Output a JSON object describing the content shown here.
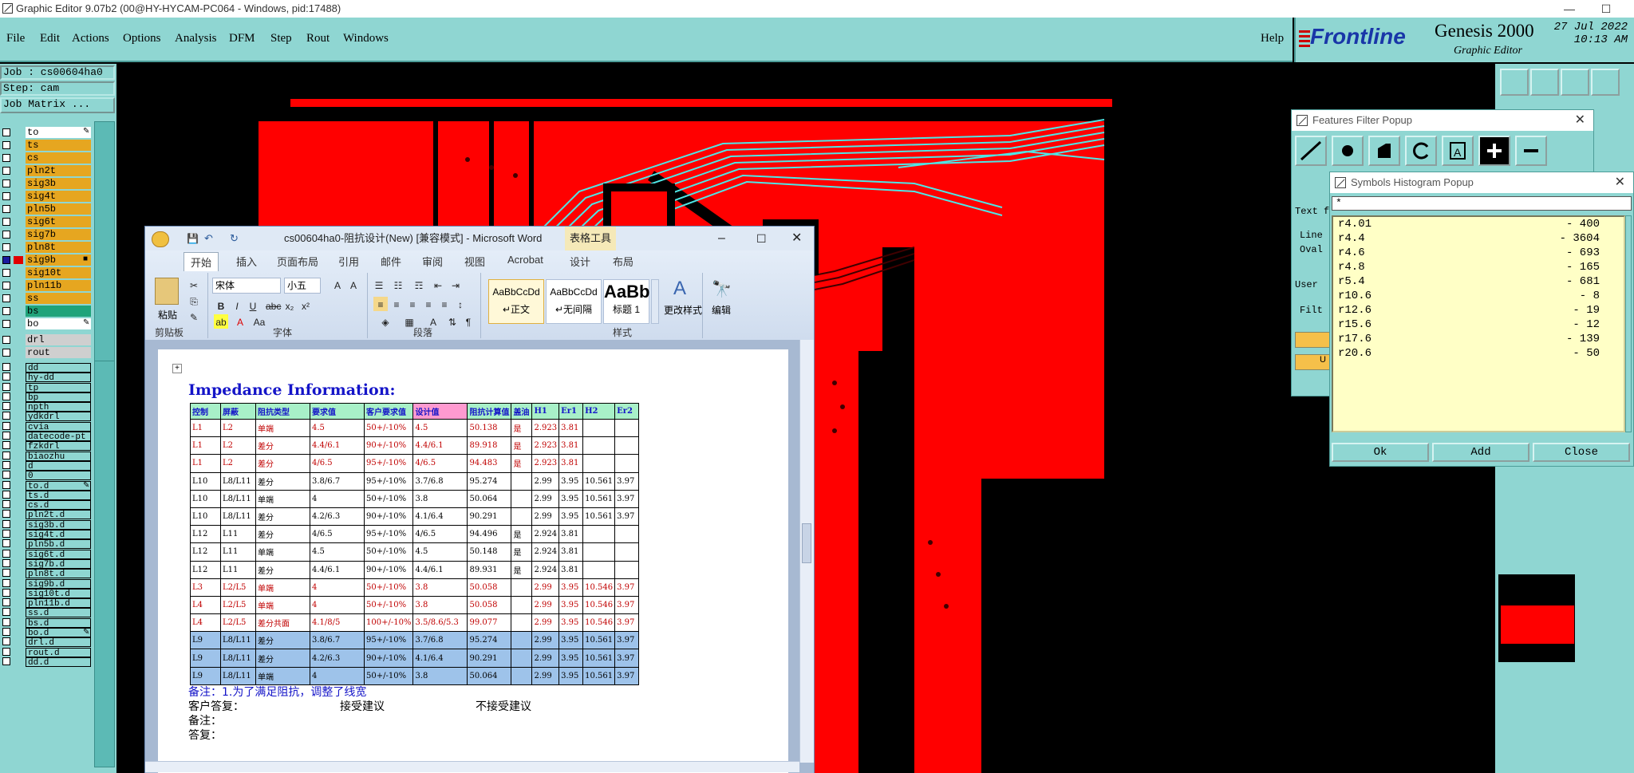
{
  "window": {
    "title": "Graphic Editor 9.07b2 (00@HY-HYCAM-PC064 - Windows, pid:17488)",
    "min": "—",
    "max": "☐",
    "close": "✕"
  },
  "menu": [
    "File",
    "Edit",
    "Actions",
    "Options",
    "Analysis",
    "DFM",
    "Step",
    "Rout",
    "Windows"
  ],
  "help": "Help",
  "brand": {
    "logo": "Frontline",
    "product": "Genesis 2000",
    "subtitle": "Graphic Editor",
    "date": "27 Jul 2022",
    "time": "10:13 AM"
  },
  "job": {
    "job": "Job : cs00604ha0",
    "step": "Step: cam",
    "matrix": "Job Matrix ..."
  },
  "layers_board": [
    {
      "name": "to",
      "color": "#ffffff",
      "sel": false,
      "mark": "✎"
    },
    {
      "name": "ts",
      "color": "#e6a620",
      "sel": false
    },
    {
      "name": "cs",
      "color": "#e6a620",
      "sel": false
    },
    {
      "name": "pln2t",
      "color": "#e6a620",
      "sel": false
    },
    {
      "name": "sig3b",
      "color": "#e6a620",
      "sel": false
    },
    {
      "name": "sig4t",
      "color": "#e6a620",
      "sel": false
    },
    {
      "name": "pln5b",
      "color": "#e6a620",
      "sel": false
    },
    {
      "name": "sig6t",
      "color": "#e6a620",
      "sel": false
    },
    {
      "name": "sig7b",
      "color": "#e6a620",
      "sel": false
    },
    {
      "name": "pln8t",
      "color": "#e6a620",
      "sel": false
    },
    {
      "name": "sig9b",
      "color": "#e6a620",
      "sel": true,
      "swatch": "#e00000",
      "mark": "■"
    },
    {
      "name": "sig10t",
      "color": "#e6a620",
      "sel": false
    },
    {
      "name": "pln11b",
      "color": "#e6a620",
      "sel": false
    },
    {
      "name": "ss",
      "color": "#e6a620",
      "sel": false
    },
    {
      "name": "bs",
      "color": "#1fa37a",
      "sel": false
    },
    {
      "name": "bo",
      "color": "#ffffff",
      "sel": false,
      "mark": "✎"
    }
  ],
  "layers_drill": [
    {
      "name": "drl",
      "color": "#cfcfcf"
    },
    {
      "name": "rout",
      "color": "#cfcfcf"
    }
  ],
  "layers_misc": [
    {
      "name": "dd",
      "mark": ""
    },
    {
      "name": "hy-dd"
    },
    {
      "name": "tp"
    },
    {
      "name": "bp"
    },
    {
      "name": "npth"
    },
    {
      "name": "ydkdrl"
    },
    {
      "name": "cvia"
    },
    {
      "name": "datecode-pt"
    },
    {
      "name": "fzkdrl"
    },
    {
      "name": "biaozhu"
    },
    {
      "name": "d"
    },
    {
      "name": "0"
    },
    {
      "name": "to.d",
      "mark": "✎"
    },
    {
      "name": "ts.d"
    },
    {
      "name": "cs.d"
    },
    {
      "name": "pln2t.d"
    },
    {
      "name": "sig3b.d"
    },
    {
      "name": "sig4t.d"
    },
    {
      "name": "pln5b.d"
    },
    {
      "name": "sig6t.d"
    },
    {
      "name": "sig7b.d"
    },
    {
      "name": "pln8t.d"
    },
    {
      "name": "sig9b.d"
    },
    {
      "name": "sig10t.d"
    },
    {
      "name": "pln11b.d"
    },
    {
      "name": "ss.d"
    },
    {
      "name": "bs.d"
    },
    {
      "name": "bo.d",
      "mark": "✎"
    },
    {
      "name": "drl.d"
    },
    {
      "name": "rout.d"
    },
    {
      "name": "dd.d"
    }
  ],
  "features_filter": {
    "title": "Features Filter Popup",
    "close": "✕",
    "text_label": "Text f",
    "line_label": "Line",
    "oval_label": "Oval",
    "user_label": "User",
    "filter_label": "Filt",
    "u_label": "U"
  },
  "symbols_histogram": {
    "title": "Symbols Histogram Popup",
    "close": "✕",
    "filter": "*",
    "rows": [
      {
        "sym": "r4.01",
        "cnt": "- 400"
      },
      {
        "sym": "r4.4",
        "cnt": "- 3604"
      },
      {
        "sym": "r4.6",
        "cnt": "- 693"
      },
      {
        "sym": "r4.8",
        "cnt": "- 165"
      },
      {
        "sym": "r5.4",
        "cnt": "- 681"
      },
      {
        "sym": "r10.6",
        "cnt": "- 8"
      },
      {
        "sym": "r12.6",
        "cnt": "- 19"
      },
      {
        "sym": "r15.6",
        "cnt": "- 12"
      },
      {
        "sym": "r17.6",
        "cnt": "- 139"
      },
      {
        "sym": "r20.6",
        "cnt": "- 50"
      }
    ],
    "ok": "Ok",
    "add": "Add",
    "close_btn": "Close"
  },
  "word": {
    "title": "cs00604ha0-阻抗设计(New) [兼容模式] - Microsoft Word",
    "context_tab": "表格工具",
    "tabs": [
      "开始",
      "插入",
      "页面布局",
      "引用",
      "邮件",
      "审阅",
      "视图",
      "Acrobat",
      "设计",
      "布局"
    ],
    "font_name": "宋体",
    "font_size": "小五",
    "paste": "粘贴",
    "groups": [
      "剪贴板",
      "字体",
      "段落",
      "样式",
      "编辑"
    ],
    "styles": [
      {
        "sample": "AaBbCcDd",
        "name": "↵正文"
      },
      {
        "sample": "AaBbCcDd",
        "name": "↵无间隔"
      },
      {
        "sample": "AaBb",
        "name": "标题 1"
      }
    ],
    "change_styles": "更改样式",
    "edit": "编辑",
    "doc_title": "Impedance Information:",
    "headers": [
      "控制",
      "屏蔽",
      "阻抗类型",
      "要求值",
      "客户要求值",
      "设计值",
      "阻抗计算值",
      "盖油",
      "H1",
      "Er1",
      "H2",
      "Er2"
    ],
    "rows": [
      [
        "L1",
        "L2",
        "单端",
        "4.5",
        "50+/-10%",
        "4.5",
        "50.138",
        "是",
        "2.923",
        "3.81",
        "",
        ""
      ],
      [
        "L1",
        "L2",
        "差分",
        "4.4/6.1",
        "90+/-10%",
        "4.4/6.1",
        "89.918",
        "是",
        "2.923",
        "3.81",
        "",
        ""
      ],
      [
        "L1",
        "L2",
        "差分",
        "4/6.5",
        "95+/-10%",
        "4/6.5",
        "94.483",
        "是",
        "2.923",
        "3.81",
        "",
        ""
      ],
      [
        "L10",
        "L8/L11",
        "差分",
        "3.8/6.7",
        "95+/-10%",
        "3.7/6.8",
        "95.274",
        "",
        "2.99",
        "3.95",
        "10.561",
        "3.97"
      ],
      [
        "L10",
        "L8/L11",
        "单端",
        "4",
        "50+/-10%",
        "3.8",
        "50.064",
        "",
        "2.99",
        "3.95",
        "10.561",
        "3.97"
      ],
      [
        "L10",
        "L8/L11",
        "差分",
        "4.2/6.3",
        "90+/-10%",
        "4.1/6.4",
        "90.291",
        "",
        "2.99",
        "3.95",
        "10.561",
        "3.97"
      ],
      [
        "L12",
        "L11",
        "差分",
        "4/6.5",
        "95+/-10%",
        "4/6.5",
        "94.496",
        "是",
        "2.924",
        "3.81",
        "",
        ""
      ],
      [
        "L12",
        "L11",
        "单端",
        "4.5",
        "50+/-10%",
        "4.5",
        "50.148",
        "是",
        "2.924",
        "3.81",
        "",
        ""
      ],
      [
        "L12",
        "L11",
        "差分",
        "4.4/6.1",
        "90+/-10%",
        "4.4/6.1",
        "89.931",
        "是",
        "2.924",
        "3.81",
        "",
        ""
      ],
      [
        "L3",
        "L2/L5",
        "单端",
        "4",
        "50+/-10%",
        "3.8",
        "50.058",
        "",
        "2.99",
        "3.95",
        "10.546",
        "3.97"
      ],
      [
        "L4",
        "L2/L5",
        "单端",
        "4",
        "50+/-10%",
        "3.8",
        "50.058",
        "",
        "2.99",
        "3.95",
        "10.546",
        "3.97"
      ],
      [
        "L4",
        "L2/L5",
        "差分共面",
        "4.1/8/5",
        "100+/-10%",
        "3.5/8.6/5.3",
        "99.077",
        "",
        "2.99",
        "3.95",
        "10.546",
        "3.97"
      ],
      [
        "L9",
        "L8/L11",
        "差分",
        "3.8/6.7",
        "95+/-10%",
        "3.7/6.8",
        "95.274",
        "",
        "2.99",
        "3.95",
        "10.561",
        "3.97"
      ],
      [
        "L9",
        "L8/L11",
        "差分",
        "4.2/6.3",
        "90+/-10%",
        "4.1/6.4",
        "90.291",
        "",
        "2.99",
        "3.95",
        "10.561",
        "3.97"
      ],
      [
        "L9",
        "L8/L11",
        "单端",
        "4",
        "50+/-10%",
        "3.8",
        "50.064",
        "",
        "2.99",
        "3.95",
        "10.561",
        "3.97"
      ]
    ],
    "note1": "备注：1.为了满足阻抗，调整了线宽",
    "reply_label": "客户答复：",
    "accept": "接受建议",
    "reject": "不接受建议",
    "note2": "备注：",
    "answer": "答复："
  }
}
